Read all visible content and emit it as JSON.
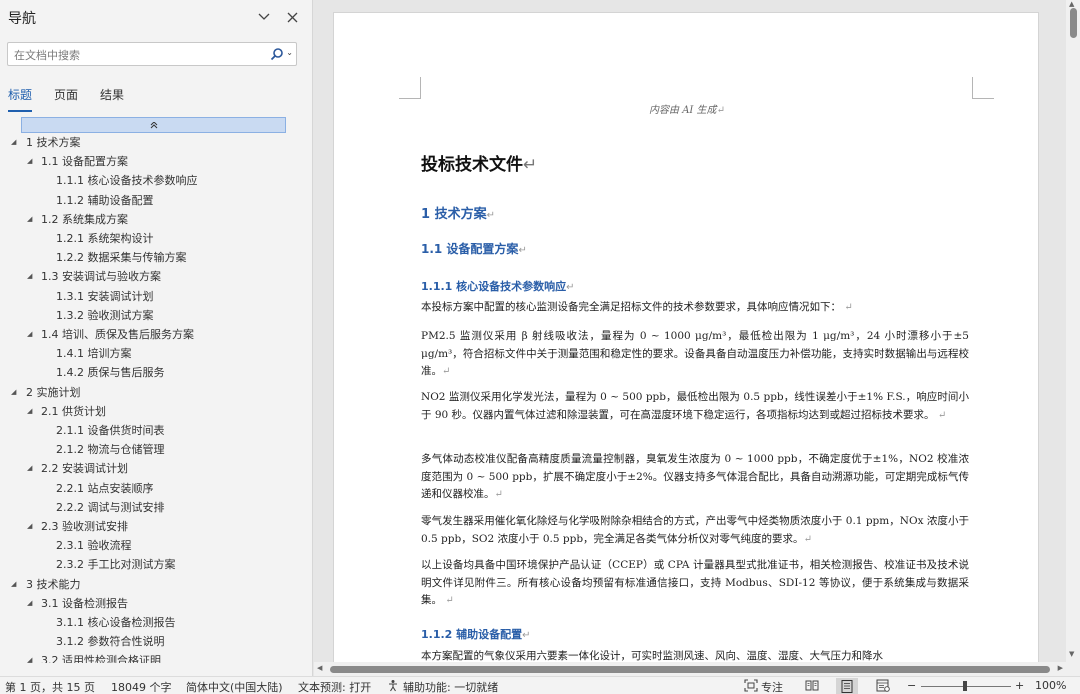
{
  "nav": {
    "title": "导航",
    "search_placeholder": "在文档中搜索",
    "tabs": [
      "标题",
      "页面",
      "结果"
    ],
    "tree": [
      {
        "label": "1 技术方案",
        "level": 0,
        "expanded": true
      },
      {
        "label": "1.1 设备配置方案",
        "level": 1,
        "expanded": true
      },
      {
        "label": "1.1.1 核心设备技术参数响应",
        "level": 2
      },
      {
        "label": "1.1.2 辅助设备配置",
        "level": 2
      },
      {
        "label": "1.2 系统集成方案",
        "level": 1,
        "expanded": true
      },
      {
        "label": "1.2.1 系统架构设计",
        "level": 2
      },
      {
        "label": "1.2.2 数据采集与传输方案",
        "level": 2
      },
      {
        "label": "1.3 安装调试与验收方案",
        "level": 1,
        "expanded": true
      },
      {
        "label": "1.3.1 安装调试计划",
        "level": 2
      },
      {
        "label": "1.3.2 验收测试方案",
        "level": 2
      },
      {
        "label": "1.4 培训、质保及售后服务方案",
        "level": 1,
        "expanded": true
      },
      {
        "label": "1.4.1 培训方案",
        "level": 2
      },
      {
        "label": "1.4.2 质保与售后服务",
        "level": 2
      },
      {
        "label": "2 实施计划",
        "level": 0,
        "expanded": true
      },
      {
        "label": "2.1 供货计划",
        "level": 1,
        "expanded": true
      },
      {
        "label": "2.1.1 设备供货时间表",
        "level": 2
      },
      {
        "label": "2.1.2 物流与仓储管理",
        "level": 2
      },
      {
        "label": "2.2 安装调试计划",
        "level": 1,
        "expanded": true
      },
      {
        "label": "2.2.1 站点安装顺序",
        "level": 2
      },
      {
        "label": "2.2.2 调试与测试安排",
        "level": 2
      },
      {
        "label": "2.3 验收测试安排",
        "level": 1,
        "expanded": true
      },
      {
        "label": "2.3.1 验收流程",
        "level": 2
      },
      {
        "label": "2.3.2 手工比对测试方案",
        "level": 2
      },
      {
        "label": "3 技术能力",
        "level": 0,
        "expanded": true
      },
      {
        "label": "3.1 设备检测报告",
        "level": 1,
        "expanded": true
      },
      {
        "label": "3.1.1 核心设备检测报告",
        "level": 2
      },
      {
        "label": "3.1.2 参数符合性说明",
        "level": 2
      },
      {
        "label": "3.2 适用性检测合格证明",
        "level": 1,
        "expanded": true
      }
    ]
  },
  "doc": {
    "ai_note": "内容由 AI 生成",
    "title": "投标技术文件",
    "h1": "1 技术方案",
    "h2": "1.1 设备配置方案",
    "h3a": "1.1.1 核心设备技术参数响应",
    "p1": "本投标方案中配置的核心监测设备完全满足招标文件的技术参数要求，具体响应情况如下：",
    "p2": "PM2.5 监测仪采用 β 射线吸收法，量程为 0 ~ 1000 μg/m³，最低检出限为 1 μg/m³，24 小时漂移小于±5 μg/m³，符合招标文件中关于测量范围和稳定性的要求。设备具备自动温度压力补偿功能，支持实时数据输出与远程校准。",
    "p3": "NO2 监测仪采用化学发光法，量程为 0 ~ 500 ppb，最低检出限为 0.5 ppb，线性误差小于±1% F.S.，响应时间小于 90 秒。仪器内置气体过滤和除湿装置，可在高湿度环境下稳定运行，各项指标均达到或超过招标技术要求。",
    "p4": "多气体动态校准仪配备高精度质量流量控制器，臭氧发生浓度为 0 ~ 1000 ppb，不确定度优于±1%，NO2 校准浓度范围为 0 ~ 500 ppb，扩展不确定度小于±2%。仪器支持多气体混合配比，具备自动溯源功能，可定期完成标气传递和仪器校准。",
    "p5": "零气发生器采用催化氧化除烃与化学吸附除杂相结合的方式，产出零气中烃类物质浓度小于 0.1 ppm，NOx 浓度小于 0.5 ppb，SO2 浓度小于 0.5 ppb，完全满足各类气体分析仪对零气纯度的要求。",
    "p6": "以上设备均具备中国环境保护产品认证（CCEP）或 CPA 计量器具型式批准证书，相关检测报告、校准证书及技术说明文件详见附件三。所有核心设备均预留有标准通信接口，支持 Modbus、SDI-12 等协议，便于系统集成与数据采集。",
    "h3b": "1.1.2 辅助设备配置",
    "p7": "本方案配置的气象仪采用六要素一体化设计，可实时监测风速、风向、温度、湿度、大气压力和降水"
  },
  "status": {
    "page": "第 1 页，共 15 页",
    "words": "18049 个字",
    "language": "简体中文(中国大陆)",
    "predict": "文本预测: 打开",
    "accessibility": "辅助功能: 一切就绪",
    "focus": "专注",
    "zoom": "100%",
    "zoom_minus": "−",
    "zoom_plus": "+"
  },
  "colors": {
    "accent": "#1f5fae",
    "heading": "#2a5ea8"
  }
}
